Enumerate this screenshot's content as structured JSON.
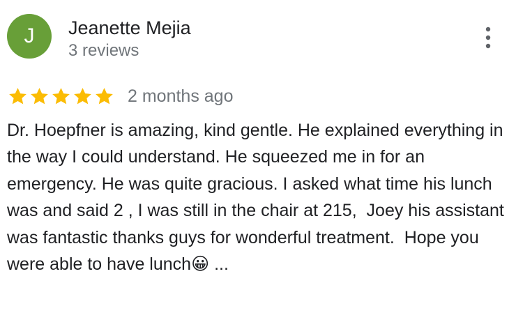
{
  "reviewer": {
    "initial": "J",
    "name": "Jeanette Mejia",
    "reviews_count": "3 reviews",
    "avatar_color": "#689f38"
  },
  "rating": {
    "stars": 5,
    "max_stars": 5,
    "star_color": "#fbbc04",
    "date": "2 months ago"
  },
  "review": {
    "text": "Dr. Hoepfner is amazing, kind gentle. He explained everything in the way I could understand. He squeezed me in for an emergency. He was quite gracious. I asked what time his lunch was and said 2 , I was still in the chair at 215,  Joey his assistant was fantastic thanks guys for wonderful treatment.  Hope you were able to have lunch😀",
    "more_label": " ..."
  },
  "menu": {
    "icon": "more-vert-icon"
  }
}
